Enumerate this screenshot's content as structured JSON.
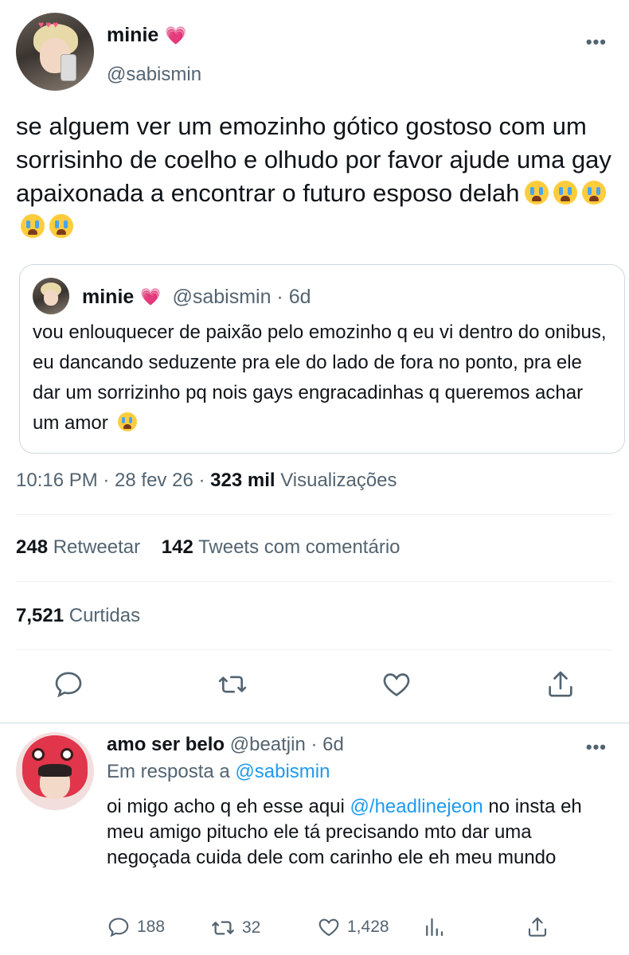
{
  "tweet": {
    "author_name": "minie",
    "author_handle": "@sabismin",
    "text": "se alguem ver um emozinho gótico gostoso com um sorrisinho de coelho e olhudo por favor ajude uma gay apaixonada a encontrar o futuro esposo delah",
    "emoji_count": 5,
    "time": "10:16 PM · 28 fev 26 ·",
    "views_count": "323 mil",
    "views_label": "Visualizações",
    "retweets_count": "248",
    "retweets_label": "Retweetar",
    "quotes_count": "142",
    "quotes_label": "Tweets com comentário",
    "likes_count": "7,521",
    "likes_label": "Curtidas"
  },
  "quoted": {
    "author_name": "minie",
    "meta": "@sabismin · 6d",
    "text": "vou enlouquecer de paixão pelo emozinho q eu vi dentro do onibus, eu dancando seduzente pra ele do lado de fora no ponto, pra ele dar um sorrizinho pq nois gays engracadinhas q queremos achar um amor"
  },
  "reply": {
    "author_name": "amo ser belo",
    "meta": "@beatjin · 6d",
    "reply_prefix": "Em resposta a",
    "reply_to": "@sabismin",
    "text_before": "oi migo acho q eh esse aqui ",
    "mention": "@/headlinejeon",
    "text_after": " no insta eh meu amigo pitucho ele tá precisando mto dar uma negoçada cuida dele com carinho ele eh meu mundo",
    "replies": "188",
    "retweets": "32",
    "likes": "1,428"
  },
  "icons": [
    "more-icon",
    "reply-icon",
    "retweet-icon",
    "like-icon",
    "share-icon",
    "analytics-icon",
    "verified-heart-icon",
    "loudly-crying-emoji"
  ],
  "colors": {
    "text": "#0f1419",
    "secondary": "#536471",
    "link": "#1d9bf0",
    "border": "#cfd9de",
    "heart": "#ff4fa0"
  }
}
